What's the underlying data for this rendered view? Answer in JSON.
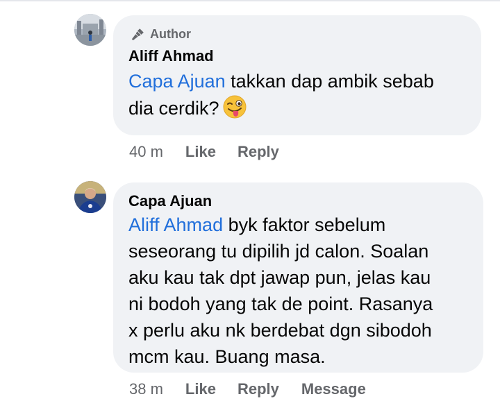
{
  "comments": [
    {
      "author_badge": "Author",
      "name": "Aliff Ahmad",
      "mention": "Capa Ajuan",
      "lines": [
        "takkan dap ambik sebab",
        "dia cerdik?"
      ],
      "emoji": "winking-face-with-tongue",
      "time": "40 m",
      "actions": [
        "Like",
        "Reply"
      ]
    },
    {
      "name": "Capa Ajuan",
      "mention": "Aliff Ahmad",
      "lines": [
        "byk faktor sebelum",
        "seseorang tu dipilih jd calon. Soalan",
        "aku kau tak dpt jawap pun, jelas kau",
        "ni bodoh yang tak de point. Rasanya",
        "x perlu aku nk berdebat dgn sibodoh",
        "mcm kau. Buang masa."
      ],
      "time": "38 m",
      "actions": [
        "Like",
        "Reply",
        "Message"
      ]
    }
  ],
  "colors": {
    "bubble": "#f0f2f5",
    "mention": "#216fdb",
    "meta": "#65676b"
  }
}
